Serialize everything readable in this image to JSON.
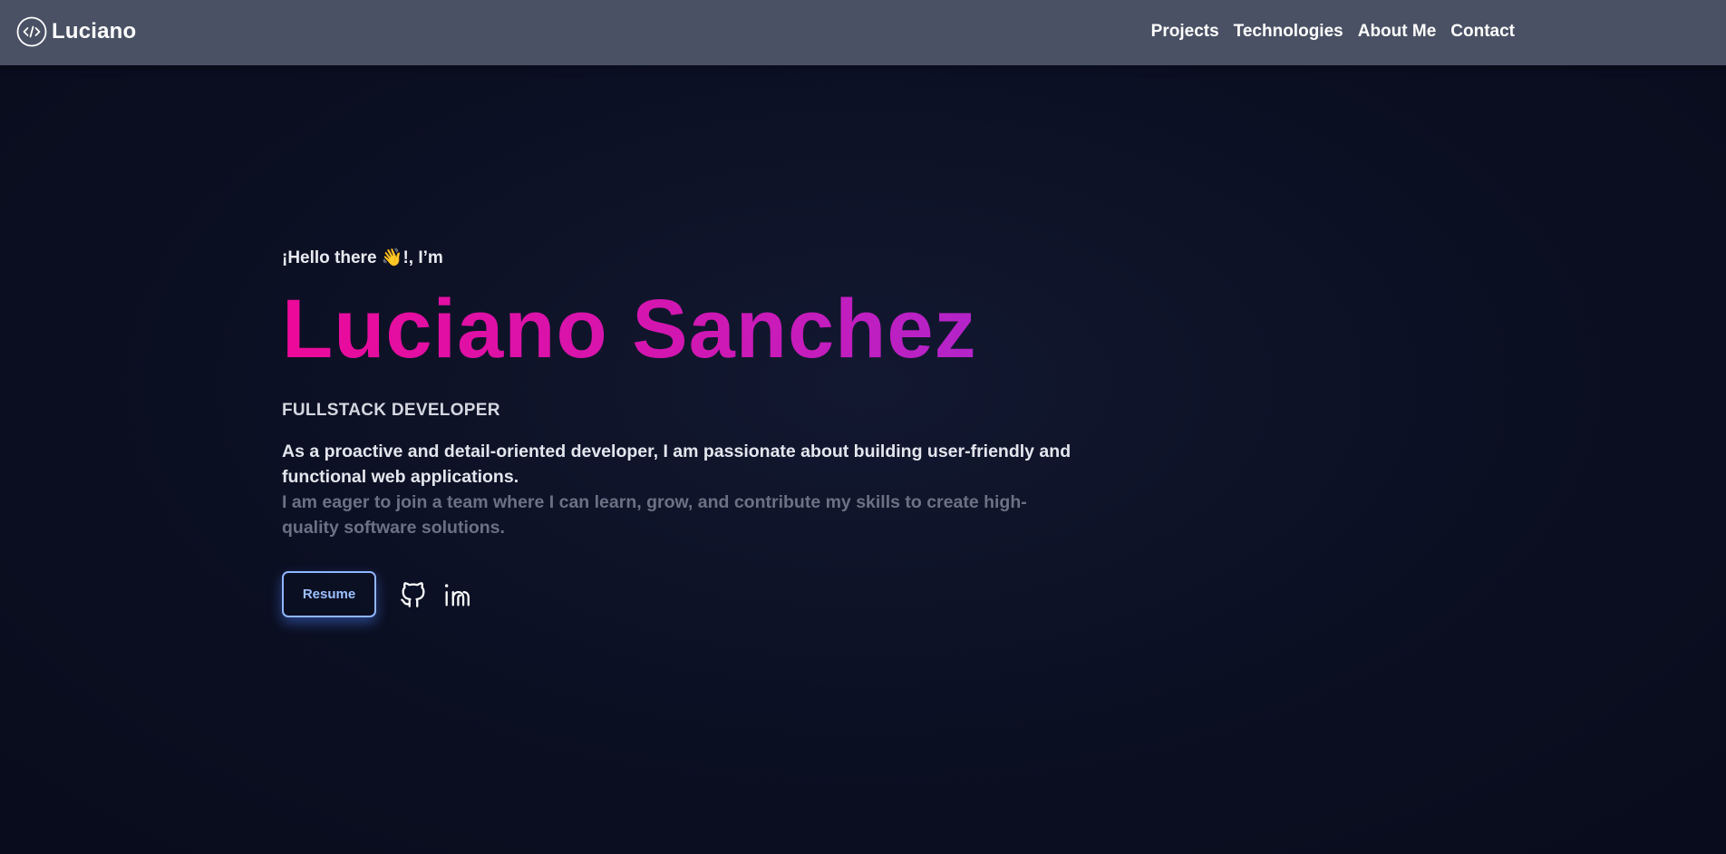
{
  "nav": {
    "brand": "Luciano",
    "links": [
      {
        "label": "Projects"
      },
      {
        "label": "Technologies"
      },
      {
        "label": "About Me"
      },
      {
        "label": "Contact"
      }
    ]
  },
  "hero": {
    "greeting": "¡Hello there 👋!, I’m",
    "name": "Luciano Sanchez",
    "role": "FULLSTACK DEVELOPER",
    "description_primary": "As a proactive and detail-oriented developer, I am passionate about building user-friendly and functional web applications.",
    "description_secondary": "I am eager to join a team where I can learn, grow, and contribute my skills to create high-quality software solutions.",
    "resume_label": "Resume",
    "social": [
      {
        "icon": "github-icon"
      },
      {
        "icon": "linkedin-icon"
      }
    ]
  },
  "colors": {
    "navbar_bg": "#4a5164",
    "page_bg": "#0b0f22",
    "name_gradient_start": "#ec0a9a",
    "name_gradient_end": "#b324c9",
    "resume_accent": "#8fb6ff",
    "muted_text": "#6c7184"
  }
}
